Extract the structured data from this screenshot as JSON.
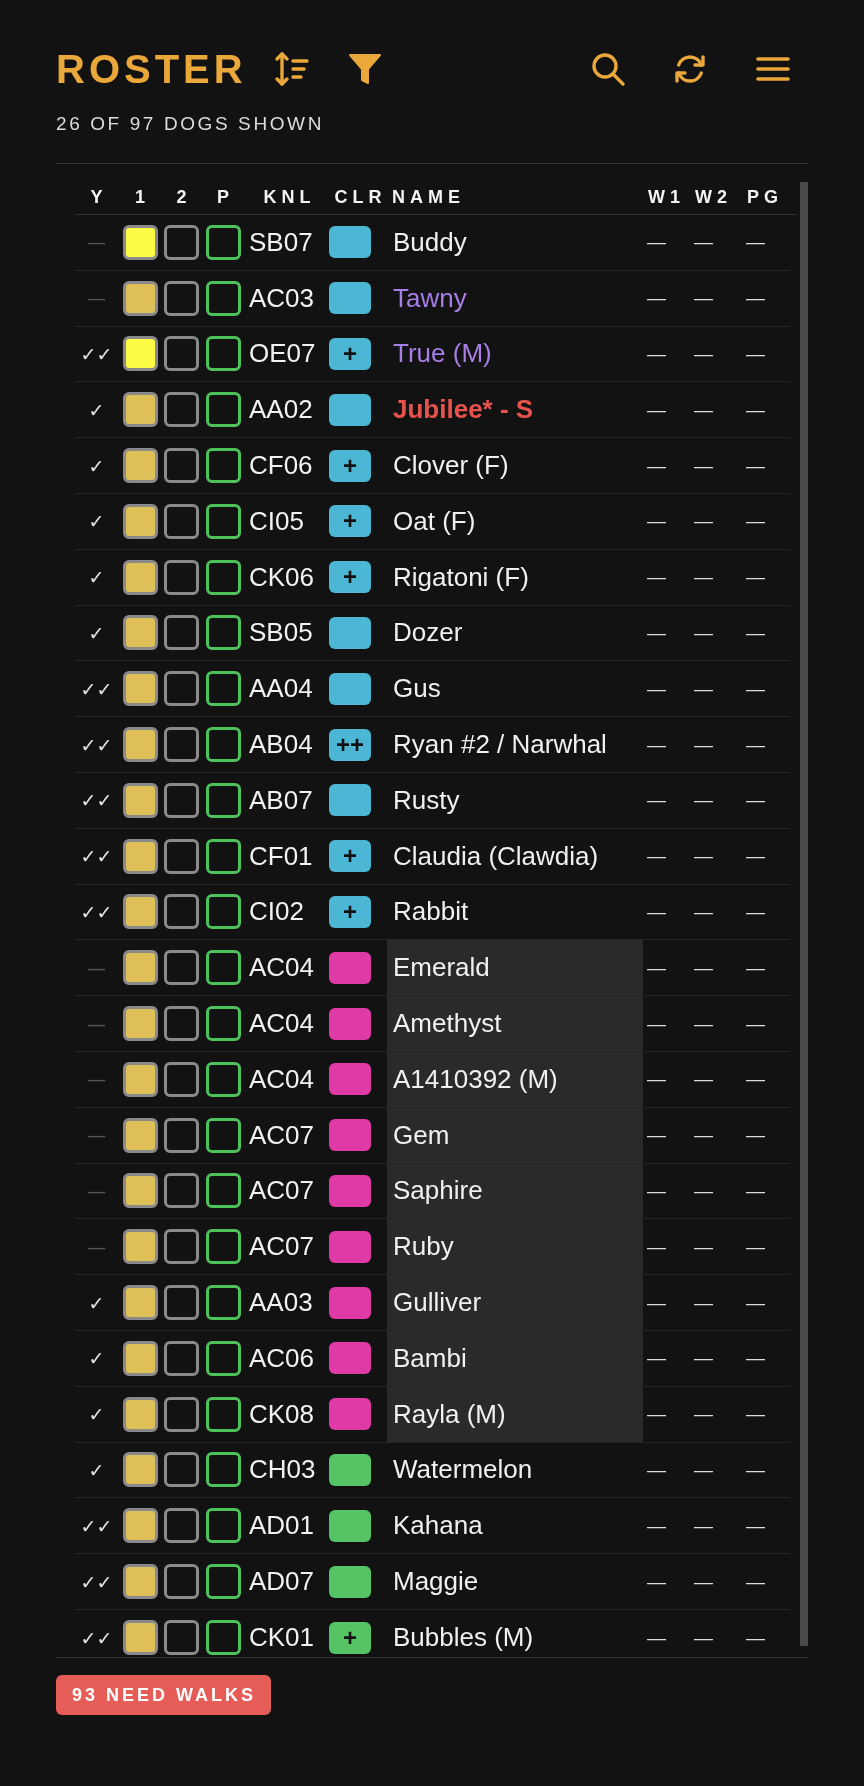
{
  "header": {
    "title": "ROSTER",
    "subtitle": "26 OF 97 DOGS SHOWN"
  },
  "table": {
    "columns": [
      "Y",
      "1",
      "2",
      "P",
      "KNL",
      "CLR",
      "NAME",
      "W1",
      "W2",
      "PG"
    ],
    "rows": [
      {
        "y": "—",
        "y_dim": true,
        "c1": true,
        "c1_bright": true,
        "c2": false,
        "p": false,
        "knl": "SB07",
        "color": "#4cb7d4",
        "name": "Buddy",
        "flagged": false,
        "urgent": false,
        "shaded": false,
        "w1": "—",
        "w2": "—",
        "pg": "—"
      },
      {
        "y": "—",
        "y_dim": true,
        "c1": true,
        "c1_bright": false,
        "c2": false,
        "p": false,
        "knl": "AC03",
        "color": "#4cb7d4",
        "name": "Tawny",
        "flagged": true,
        "urgent": false,
        "shaded": false,
        "w1": "—",
        "w2": "—",
        "pg": "—"
      },
      {
        "y": "✓✓",
        "y_dim": false,
        "c1": true,
        "c1_bright": true,
        "c2": false,
        "p": false,
        "knl": "OE07",
        "color": "#4cb7d4",
        "tag": "+",
        "name": "True (M)",
        "flagged": true,
        "urgent": false,
        "shaded": false,
        "w1": "—",
        "w2": "—",
        "pg": "—"
      },
      {
        "y": "✓",
        "y_dim": false,
        "c1": true,
        "c1_bright": false,
        "c2": false,
        "p": false,
        "knl": "AA02",
        "color": "#4cb7d4",
        "name": "Jubilee* - S",
        "flagged": false,
        "urgent": true,
        "shaded": false,
        "w1": "—",
        "w2": "—",
        "pg": "—"
      },
      {
        "y": "✓",
        "y_dim": false,
        "c1": true,
        "c1_bright": false,
        "c2": false,
        "p": false,
        "knl": "CF06",
        "color": "#4cb7d4",
        "tag": "+",
        "name": "Clover (F)",
        "flagged": false,
        "urgent": false,
        "shaded": false,
        "w1": "—",
        "w2": "—",
        "pg": "—"
      },
      {
        "y": "✓",
        "y_dim": false,
        "c1": true,
        "c1_bright": false,
        "c2": false,
        "p": false,
        "knl": "CI05",
        "color": "#4cb7d4",
        "tag": "+",
        "name": "Oat (F)",
        "flagged": false,
        "urgent": false,
        "shaded": false,
        "w1": "—",
        "w2": "—",
        "pg": "—"
      },
      {
        "y": "✓",
        "y_dim": false,
        "c1": true,
        "c1_bright": false,
        "c2": false,
        "p": false,
        "knl": "CK06",
        "color": "#4cb7d4",
        "tag": "+",
        "name": "Rigatoni (F)",
        "flagged": false,
        "urgent": false,
        "shaded": false,
        "w1": "—",
        "w2": "—",
        "pg": "—"
      },
      {
        "y": "✓",
        "y_dim": false,
        "c1": true,
        "c1_bright": false,
        "c2": false,
        "p": false,
        "knl": "SB05",
        "color": "#4cb7d4",
        "name": "Dozer",
        "flagged": false,
        "urgent": false,
        "shaded": false,
        "w1": "—",
        "w2": "—",
        "pg": "—"
      },
      {
        "y": "✓✓",
        "y_dim": false,
        "c1": true,
        "c1_bright": false,
        "c2": false,
        "p": false,
        "knl": "AA04",
        "color": "#4cb7d4",
        "name": "Gus",
        "flagged": false,
        "urgent": false,
        "shaded": false,
        "w1": "—",
        "w2": "—",
        "pg": "—"
      },
      {
        "y": "✓✓",
        "y_dim": false,
        "c1": true,
        "c1_bright": false,
        "c2": false,
        "p": false,
        "knl": "AB04",
        "color": "#4cb7d4",
        "tag": "++",
        "name": "Ryan #2 / Narwhal",
        "flagged": false,
        "urgent": false,
        "shaded": false,
        "w1": "—",
        "w2": "—",
        "pg": "—"
      },
      {
        "y": "✓✓",
        "y_dim": false,
        "c1": true,
        "c1_bright": false,
        "c2": false,
        "p": false,
        "knl": "AB07",
        "color": "#4cb7d4",
        "name": "Rusty",
        "flagged": false,
        "urgent": false,
        "shaded": false,
        "w1": "—",
        "w2": "—",
        "pg": "—"
      },
      {
        "y": "✓✓",
        "y_dim": false,
        "c1": true,
        "c1_bright": false,
        "c2": false,
        "p": false,
        "knl": "CF01",
        "color": "#4cb7d4",
        "tag": "+",
        "name": "Claudia (Clawdia)",
        "flagged": false,
        "urgent": false,
        "shaded": false,
        "w1": "—",
        "w2": "—",
        "pg": "—"
      },
      {
        "y": "✓✓",
        "y_dim": false,
        "c1": true,
        "c1_bright": false,
        "c2": false,
        "p": false,
        "knl": "CI02",
        "color": "#4cb7d4",
        "tag": "+",
        "name": "Rabbit",
        "flagged": false,
        "urgent": false,
        "shaded": false,
        "w1": "—",
        "w2": "—",
        "pg": "—"
      },
      {
        "y": "—",
        "y_dim": true,
        "c1": true,
        "c1_bright": false,
        "c2": false,
        "p": false,
        "knl": "AC04",
        "color": "#e03aa7",
        "name": "Emerald",
        "flagged": false,
        "urgent": false,
        "shaded": true,
        "w1": "—",
        "w2": "—",
        "pg": "—"
      },
      {
        "y": "—",
        "y_dim": true,
        "c1": true,
        "c1_bright": false,
        "c2": false,
        "p": false,
        "knl": "AC04",
        "color": "#e03aa7",
        "name": "Amethyst",
        "flagged": false,
        "urgent": false,
        "shaded": true,
        "w1": "—",
        "w2": "—",
        "pg": "—"
      },
      {
        "y": "—",
        "y_dim": true,
        "c1": true,
        "c1_bright": false,
        "c2": false,
        "p": false,
        "knl": "AC04",
        "color": "#e03aa7",
        "name": "A1410392 (M)",
        "flagged": false,
        "urgent": false,
        "shaded": true,
        "w1": "—",
        "w2": "—",
        "pg": "—"
      },
      {
        "y": "—",
        "y_dim": true,
        "c1": true,
        "c1_bright": false,
        "c2": false,
        "p": false,
        "knl": "AC07",
        "color": "#e03aa7",
        "name": "Gem",
        "flagged": false,
        "urgent": false,
        "shaded": true,
        "w1": "—",
        "w2": "—",
        "pg": "—"
      },
      {
        "y": "—",
        "y_dim": true,
        "c1": true,
        "c1_bright": false,
        "c2": false,
        "p": false,
        "knl": "AC07",
        "color": "#e03aa7",
        "name": "Saphire",
        "flagged": false,
        "urgent": false,
        "shaded": true,
        "w1": "—",
        "w2": "—",
        "pg": "—"
      },
      {
        "y": "—",
        "y_dim": true,
        "c1": true,
        "c1_bright": false,
        "c2": false,
        "p": false,
        "knl": "AC07",
        "color": "#e03aa7",
        "name": "Ruby",
        "flagged": false,
        "urgent": false,
        "shaded": true,
        "w1": "—",
        "w2": "—",
        "pg": "—"
      },
      {
        "y": "✓",
        "y_dim": false,
        "c1": true,
        "c1_bright": false,
        "c2": false,
        "p": false,
        "knl": "AA03",
        "color": "#e03aa7",
        "name": "Gulliver",
        "flagged": false,
        "urgent": false,
        "shaded": true,
        "w1": "—",
        "w2": "—",
        "pg": "—"
      },
      {
        "y": "✓",
        "y_dim": false,
        "c1": true,
        "c1_bright": false,
        "c2": false,
        "p": false,
        "knl": "AC06",
        "color": "#e03aa7",
        "name": "Bambi",
        "flagged": false,
        "urgent": false,
        "shaded": true,
        "w1": "—",
        "w2": "—",
        "pg": "—"
      },
      {
        "y": "✓",
        "y_dim": false,
        "c1": true,
        "c1_bright": false,
        "c2": false,
        "p": false,
        "knl": "CK08",
        "color": "#e03aa7",
        "name": "Rayla (M)",
        "flagged": false,
        "urgent": false,
        "shaded": true,
        "w1": "—",
        "w2": "—",
        "pg": "—"
      },
      {
        "y": "✓",
        "y_dim": false,
        "c1": true,
        "c1_bright": false,
        "c2": false,
        "p": false,
        "knl": "CH03",
        "color": "#56c464",
        "name": "Watermelon",
        "flagged": false,
        "urgent": false,
        "shaded": false,
        "w1": "—",
        "w2": "—",
        "pg": "—"
      },
      {
        "y": "✓✓",
        "y_dim": false,
        "c1": true,
        "c1_bright": false,
        "c2": false,
        "p": false,
        "knl": "AD01",
        "color": "#56c464",
        "name": "Kahana",
        "flagged": false,
        "urgent": false,
        "shaded": false,
        "w1": "—",
        "w2": "—",
        "pg": "—"
      },
      {
        "y": "✓✓",
        "y_dim": false,
        "c1": true,
        "c1_bright": false,
        "c2": false,
        "p": false,
        "knl": "AD07",
        "color": "#56c464",
        "name": "Maggie",
        "flagged": false,
        "urgent": false,
        "shaded": false,
        "w1": "—",
        "w2": "—",
        "pg": "—"
      },
      {
        "y": "✓✓",
        "y_dim": false,
        "c1": true,
        "c1_bright": false,
        "c2": false,
        "p": false,
        "knl": "CK01",
        "color": "#56c464",
        "tag": "+",
        "name": "Bubbles (M)",
        "flagged": false,
        "urgent": false,
        "shaded": false,
        "w1": "—",
        "w2": "—",
        "pg": "—"
      }
    ]
  },
  "footer": {
    "badge": "93 NEED WALKS"
  }
}
